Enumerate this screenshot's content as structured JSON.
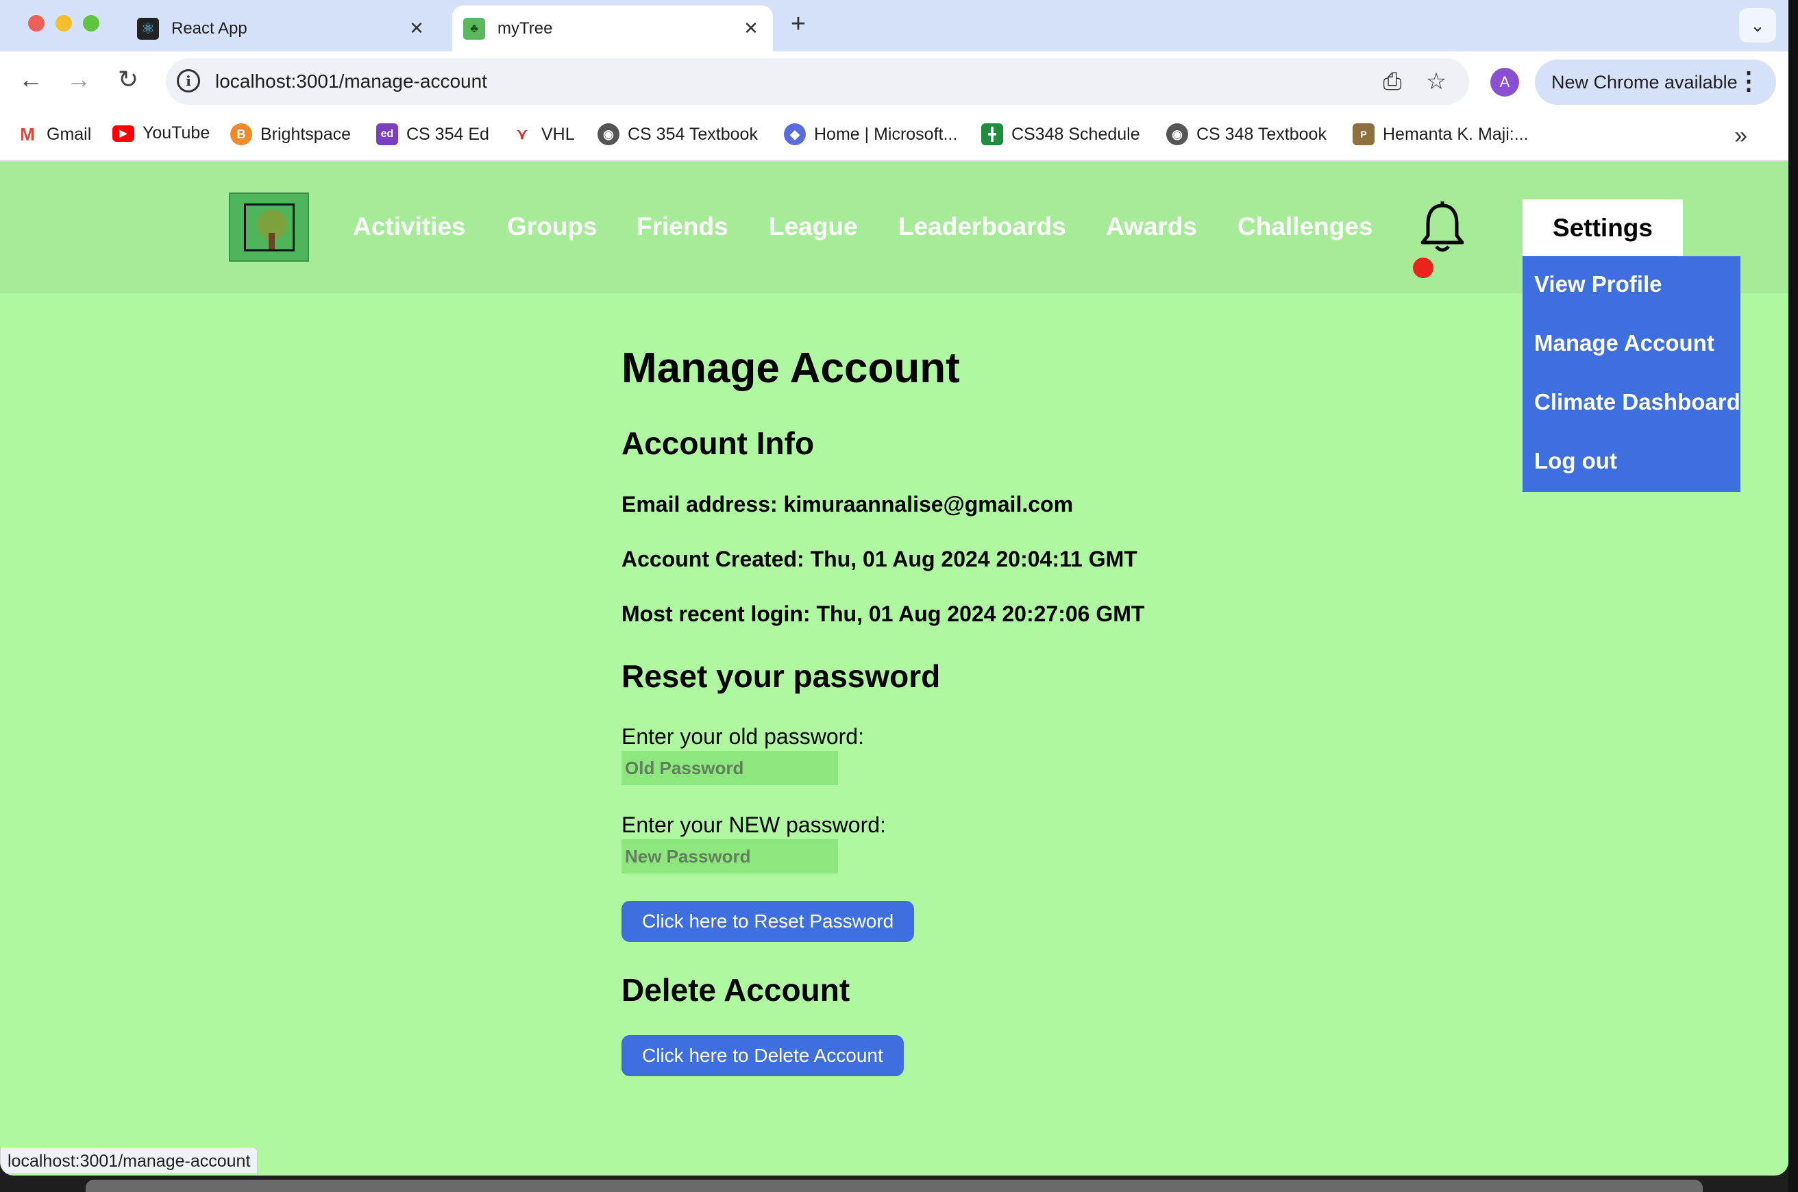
{
  "browser": {
    "tabs": [
      {
        "title": "React App",
        "favicon": "react-icon",
        "active": false
      },
      {
        "title": "myTree",
        "favicon": "tree-icon",
        "active": true
      }
    ],
    "url": "localhost:3001/manage-account",
    "profile_initial": "A",
    "update_label": "New Chrome available",
    "bookmarks": [
      {
        "label": "Gmail",
        "icon": "gmail-icon",
        "color": "#ea4335"
      },
      {
        "label": "YouTube",
        "icon": "youtube-icon",
        "color": "#ff0000"
      },
      {
        "label": "Brightspace",
        "icon": "brightspace-icon",
        "color": "#f08a24"
      },
      {
        "label": "CS 354 Ed",
        "icon": "ed-icon",
        "color": "#7b3fbf"
      },
      {
        "label": "VHL",
        "icon": "vhl-icon",
        "color": "#d32f2f"
      },
      {
        "label": "CS 354 Textbook",
        "icon": "globe-icon",
        "color": "#555555"
      },
      {
        "label": "Home | Microsoft...",
        "icon": "microsoft-icon",
        "color": "#5b6bdb"
      },
      {
        "label": "CS348 Schedule",
        "icon": "sheets-icon",
        "color": "#1e8e3e"
      },
      {
        "label": "CS 348 Textbook",
        "icon": "globe-icon",
        "color": "#555555"
      },
      {
        "label": "Hemanta K. Maji:...",
        "icon": "purdue-icon",
        "color": "#8e6f3e"
      }
    ],
    "status_url": "localhost:3001/manage-account"
  },
  "nav": {
    "links": [
      "Activities",
      "Groups",
      "Friends",
      "League",
      "Leaderboards",
      "Awards",
      "Challenges"
    ],
    "settings_label": "Settings",
    "dropdown": [
      "View Profile",
      "Manage Account",
      "Climate Dashboard",
      "Log out"
    ]
  },
  "page": {
    "title": "Manage Account",
    "account_info_heading": "Account Info",
    "email_line": "Email address: kimuraannalise@gmail.com",
    "created_line": "Account Created: Thu, 01 Aug 2024 20:04:11 GMT",
    "login_line": "Most recent login: Thu, 01 Aug 2024 20:27:06 GMT",
    "reset_heading": "Reset your password",
    "old_pw_label": "Enter your old password:",
    "old_pw_placeholder": "Old Password",
    "new_pw_label": "Enter your NEW password:",
    "new_pw_placeholder": "New Password",
    "reset_button": "Click here to Reset Password",
    "delete_heading": "Delete Account",
    "delete_button": "Click here to Delete Account"
  },
  "colors": {
    "page_bg": "#b0f7a2",
    "nav_bg": "#a6ec98",
    "accent_blue": "#3f6fde",
    "notification_dot": "#e8241c"
  }
}
